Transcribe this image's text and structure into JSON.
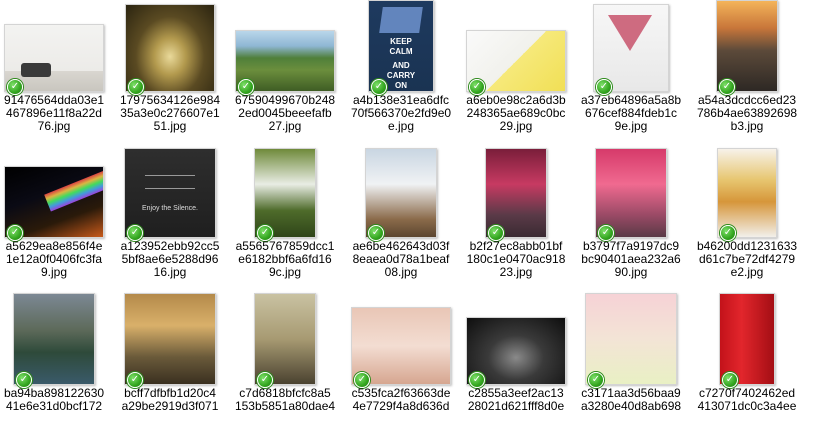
{
  "files": [
    {
      "name_lines": [
        "91476564dda03e1",
        "467896e11f8a22d",
        "76.jpg"
      ],
      "selected": true,
      "thumb": "man-balloons",
      "art_text": []
    },
    {
      "name_lines": [
        "17975634126e984",
        "35a3e0c276607e1",
        "51.jpg"
      ],
      "selected": true,
      "thumb": "forest-path",
      "art_text": []
    },
    {
      "name_lines": [
        "67590499670b248",
        "2ed0045beeefafb",
        "27.jpg"
      ],
      "selected": true,
      "thumb": "mountain-ruins",
      "art_text": []
    },
    {
      "name_lines": [
        "a4b138e31ea6dfc",
        "70f566370e2fd9e0",
        "e.jpg"
      ],
      "selected": true,
      "thumb": "keep-calm",
      "art_text": [
        "KEEP",
        "CALM",
        "AND",
        "CARRY",
        "ON"
      ]
    },
    {
      "name_lines": [
        "a6eb0e98c2a6d3b",
        "248365ae689c0bc",
        "29.jpg"
      ],
      "selected": true,
      "thumb": "calendar-note",
      "art_text": []
    },
    {
      "name_lines": [
        "a37eb64896a5a8b",
        "676cef884fdeb1c",
        "9e.jpg"
      ],
      "selected": true,
      "thumb": "sketch-face",
      "art_text": []
    },
    {
      "name_lines": [
        "a54a3dcdcc6ed23",
        "786b4ae63892698",
        "b3.jpg"
      ],
      "selected": true,
      "thumb": "city-sunset",
      "art_text": []
    },
    {
      "name_lines": [
        "a5629ea8e856f4e",
        "1e12a0f0406fc3fa",
        "9.jpg"
      ],
      "selected": true,
      "thumb": "light-beam",
      "art_text": []
    },
    {
      "name_lines": [
        "a123952ebb92cc5",
        "5bf8ae6e5288d96",
        "16.jpg"
      ],
      "selected": true,
      "thumb": "silence",
      "art_text": [
        "Enjoy the Silence."
      ]
    },
    {
      "name_lines": [
        "a5565767859dcc1",
        "e6182bbf6a6fd16",
        "9c.jpg"
      ],
      "selected": true,
      "thumb": "waterfall",
      "art_text": []
    },
    {
      "name_lines": [
        "ae6be462643d03f",
        "8eaea0d78a1beaf",
        "08.jpg"
      ],
      "selected": true,
      "thumb": "snow-mountains",
      "art_text": []
    },
    {
      "name_lines": [
        "b2f27ec8abb01bf",
        "180c1e0470ac918",
        "23.jpg"
      ],
      "selected": true,
      "thumb": "pink-street",
      "art_text": []
    },
    {
      "name_lines": [
        "b3797f7a9197dc9",
        "bc90401aea232a6",
        "90.jpg"
      ],
      "selected": true,
      "thumb": "pink-trees",
      "art_text": []
    },
    {
      "name_lines": [
        "b46200dd1231633",
        "d61c7be72df4279",
        "e2.jpg"
      ],
      "selected": true,
      "thumb": "food",
      "art_text": []
    },
    {
      "name_lines": [
        "ba94ba898122630",
        "41e6e31d0bcf172"
      ],
      "selected": true,
      "thumb": "lake-church",
      "art_text": []
    },
    {
      "name_lines": [
        "bcff7dfbfb1d20c4",
        "a29be2919d3f071"
      ],
      "selected": true,
      "thumb": "misty-cliffs",
      "art_text": []
    },
    {
      "name_lines": [
        "c7d6818bfcfc8a5",
        "153b5851a80dae4"
      ],
      "selected": true,
      "thumb": "street-lamps",
      "art_text": []
    },
    {
      "name_lines": [
        "c535fca2f63663de",
        "4e7729f4a8d636d"
      ],
      "selected": true,
      "thumb": "stamp",
      "art_text": []
    },
    {
      "name_lines": [
        "c2855a3eef2ac13",
        "28021d621fff8d0e"
      ],
      "selected": true,
      "thumb": "dark-clouds",
      "art_text": []
    },
    {
      "name_lines": [
        "c3171aa3d56baa9",
        "a3280e40d8ab698"
      ],
      "selected": true,
      "thumb": "ice-cream",
      "art_text": []
    },
    {
      "name_lines": [
        "c7270f7402462ed",
        "413071dc0c3a4ee"
      ],
      "selected": true,
      "thumb": "red-building",
      "art_text": []
    }
  ],
  "check_mark": "✓",
  "colors": {
    "check_green": "#33a51f",
    "thumb_border": "#d4d4d4"
  }
}
